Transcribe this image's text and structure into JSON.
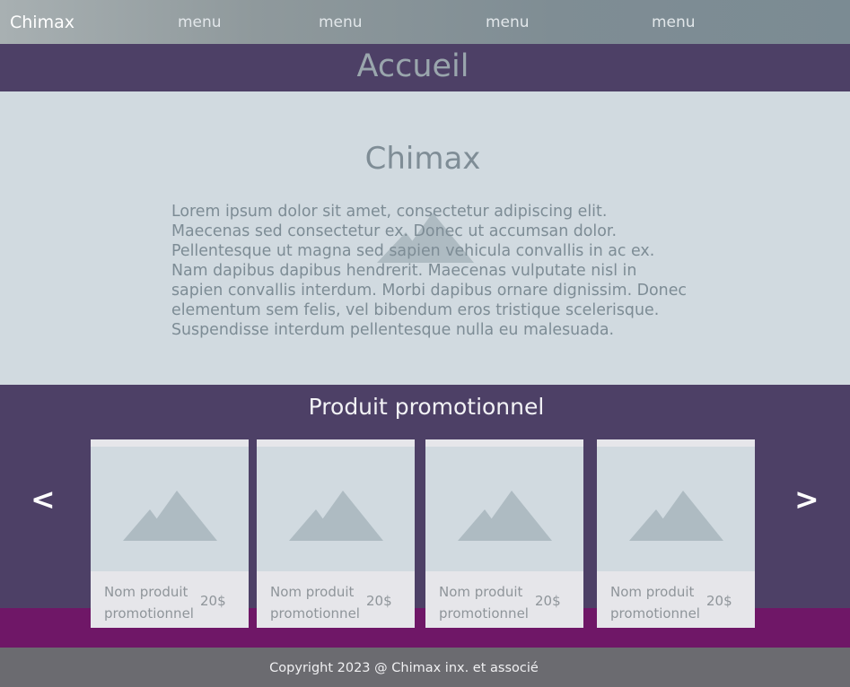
{
  "nav": {
    "brand": "Chimax",
    "menu": [
      "menu",
      "menu",
      "menu",
      "menu"
    ]
  },
  "title_bar": {
    "title": "Accueil"
  },
  "hero": {
    "title": "Chimax",
    "text": "Lorem ipsum dolor sit amet, consectetur adipiscing elit. Maecenas sed consectetur ex. Donec ut accumsan dolor. Pellentesque ut magna sed sapien vehicula convallis in ac ex. Nam dapibus dapibus hendrerit. Maecenas vulputate nisl in sapien convallis interdum. Morbi dapibus ornare dignissim. Donec elementum sem felis, vel bibendum eros tristique scelerisque. Suspendisse interdum pellentesque nulla eu malesuada.",
    "background_icon": "image-placeholder-icon"
  },
  "promo": {
    "title": "Produit promotionnel",
    "prev_label": "<",
    "next_label": ">",
    "products": [
      {
        "name": "Nom produit promotionnel",
        "price": "20$"
      },
      {
        "name": "Nom produit promotionnel",
        "price": "20$"
      },
      {
        "name": "Nom produit promotionnel",
        "price": "20$"
      },
      {
        "name": "Nom produit promotionnel",
        "price": "20$"
      }
    ]
  },
  "footer": {
    "copyright": "Copyright 2023 @ Chimax inx. et associé"
  },
  "colors": {
    "header_gradient": "#8f999c",
    "title_bar": "#4d4066",
    "hero_bg": "#d1dae0",
    "accent": "#6f1767",
    "footer": "#6b6b70",
    "card_bg": "#e6e6ea",
    "placeholder_icon": "#aebbc2"
  }
}
